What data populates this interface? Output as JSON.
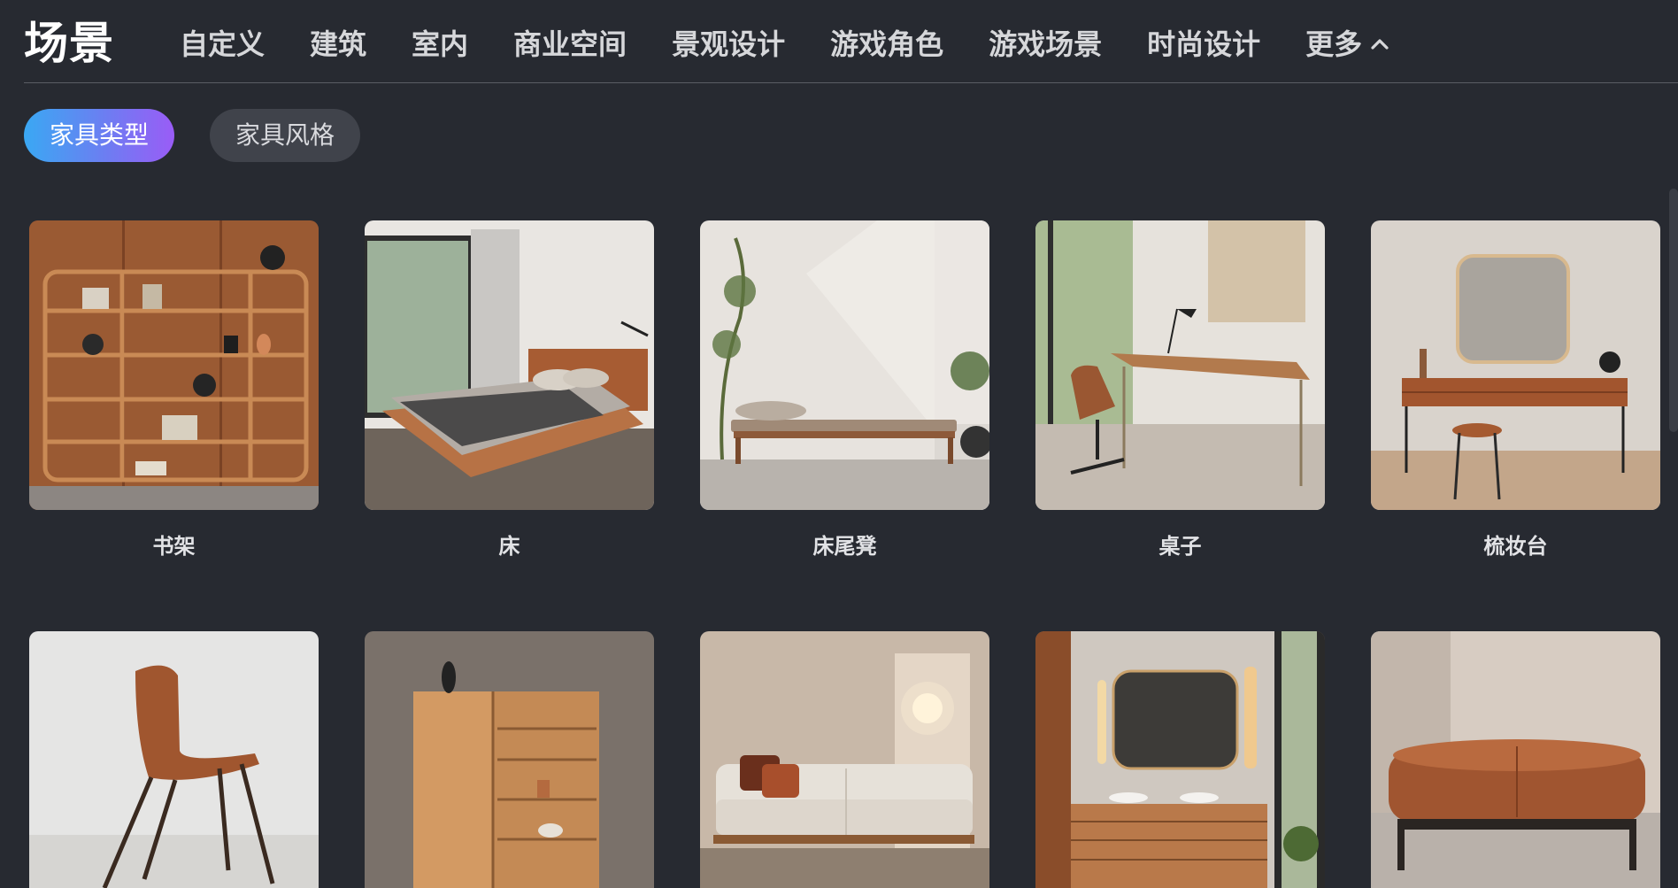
{
  "header": {
    "title": "场景",
    "nav": [
      "自定义",
      "建筑",
      "室内",
      "商业空间",
      "景观设计",
      "游戏角色",
      "游戏场景",
      "时尚设计"
    ],
    "more_label": "更多"
  },
  "filters": {
    "chips": [
      {
        "label": "家具类型",
        "active": true
      },
      {
        "label": "家具风格",
        "active": false
      }
    ]
  },
  "gallery": {
    "row1": [
      {
        "label": "书架"
      },
      {
        "label": "床"
      },
      {
        "label": "床尾凳"
      },
      {
        "label": "桌子"
      },
      {
        "label": "梳妆台"
      }
    ],
    "row2": [
      {
        "name": "chair"
      },
      {
        "name": "cabinet"
      },
      {
        "name": "sofa"
      },
      {
        "name": "bathroom-vanity"
      },
      {
        "name": "ottoman"
      }
    ]
  },
  "colors": {
    "background": "#272a31",
    "chip_gradient": [
      "#3aa8f3",
      "#9a5cf6"
    ],
    "wood": "#a5643a"
  }
}
